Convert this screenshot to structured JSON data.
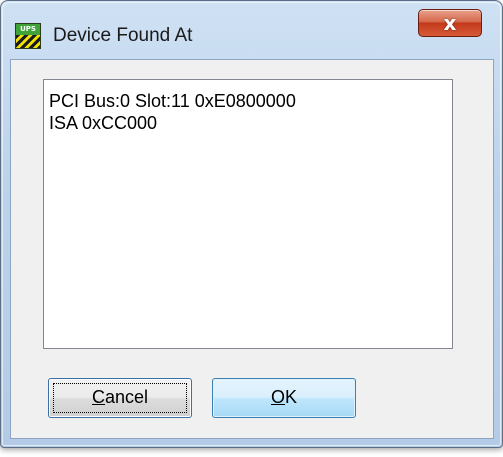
{
  "window": {
    "title": "Device Found At",
    "icon": "ups-app-icon",
    "icon_text": "UPS",
    "close_glyph": "x"
  },
  "device_list": {
    "items": [
      "PCI Bus:0 Slot:11 0xE0800000",
      "ISA 0xCC000"
    ]
  },
  "buttons": {
    "cancel": {
      "mnemonic": "C",
      "rest": "ancel"
    },
    "ok": {
      "mnemonic": "O",
      "rest": "K"
    }
  },
  "colors": {
    "close_button": "#c3391b",
    "ok_button": "#bee6fd",
    "title_bar": "#bcd3ec"
  }
}
